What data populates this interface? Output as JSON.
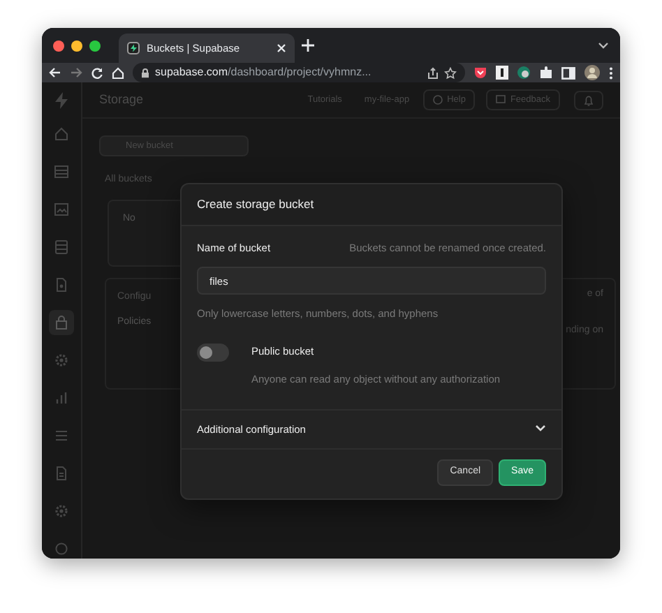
{
  "browser": {
    "tab_title": "Buckets | Supabase",
    "url_host": "supabase.com",
    "url_path": "/dashboard/project/vyhmnz..."
  },
  "sidebar": {
    "items": [
      {
        "kind": "home",
        "selected": false
      },
      {
        "kind": "table",
        "selected": false
      },
      {
        "kind": "image",
        "selected": false
      },
      {
        "kind": "database",
        "selected": false
      },
      {
        "kind": "file",
        "selected": false
      },
      {
        "kind": "lock",
        "selected": true
      },
      {
        "kind": "gear",
        "selected": false
      },
      {
        "kind": "chart",
        "selected": false
      },
      {
        "kind": "list",
        "selected": false
      },
      {
        "kind": "doc",
        "selected": false
      },
      {
        "kind": "gear",
        "selected": false
      },
      {
        "kind": "circle",
        "selected": false
      }
    ]
  },
  "header": {
    "title": "Storage",
    "links": [
      "Tutorials",
      "my-file-app"
    ],
    "buttons": [
      "Help",
      "Feedback"
    ]
  },
  "page": {
    "new_button": "New bucket",
    "section_label": "All buckets",
    "card_title": "No",
    "config_label": "Configu",
    "policies_label": "Policies",
    "right_text_1": "e of",
    "right_text_2": "nding on"
  },
  "modal": {
    "title": "Create storage bucket",
    "name_label": "Name of bucket",
    "name_note": "Buckets cannot be renamed once created.",
    "name_value": "files",
    "name_help": "Only lowercase letters, numbers, dots, and hyphens",
    "public": {
      "label": "Public bucket",
      "description": "Anyone can read any object without any authorization",
      "on": false
    },
    "additional": {
      "label": "Additional configuration",
      "expanded": false
    },
    "buttons": [
      {
        "label": "Cancel",
        "kind": "secondary"
      },
      {
        "label": "Save",
        "kind": "primary"
      }
    ]
  }
}
